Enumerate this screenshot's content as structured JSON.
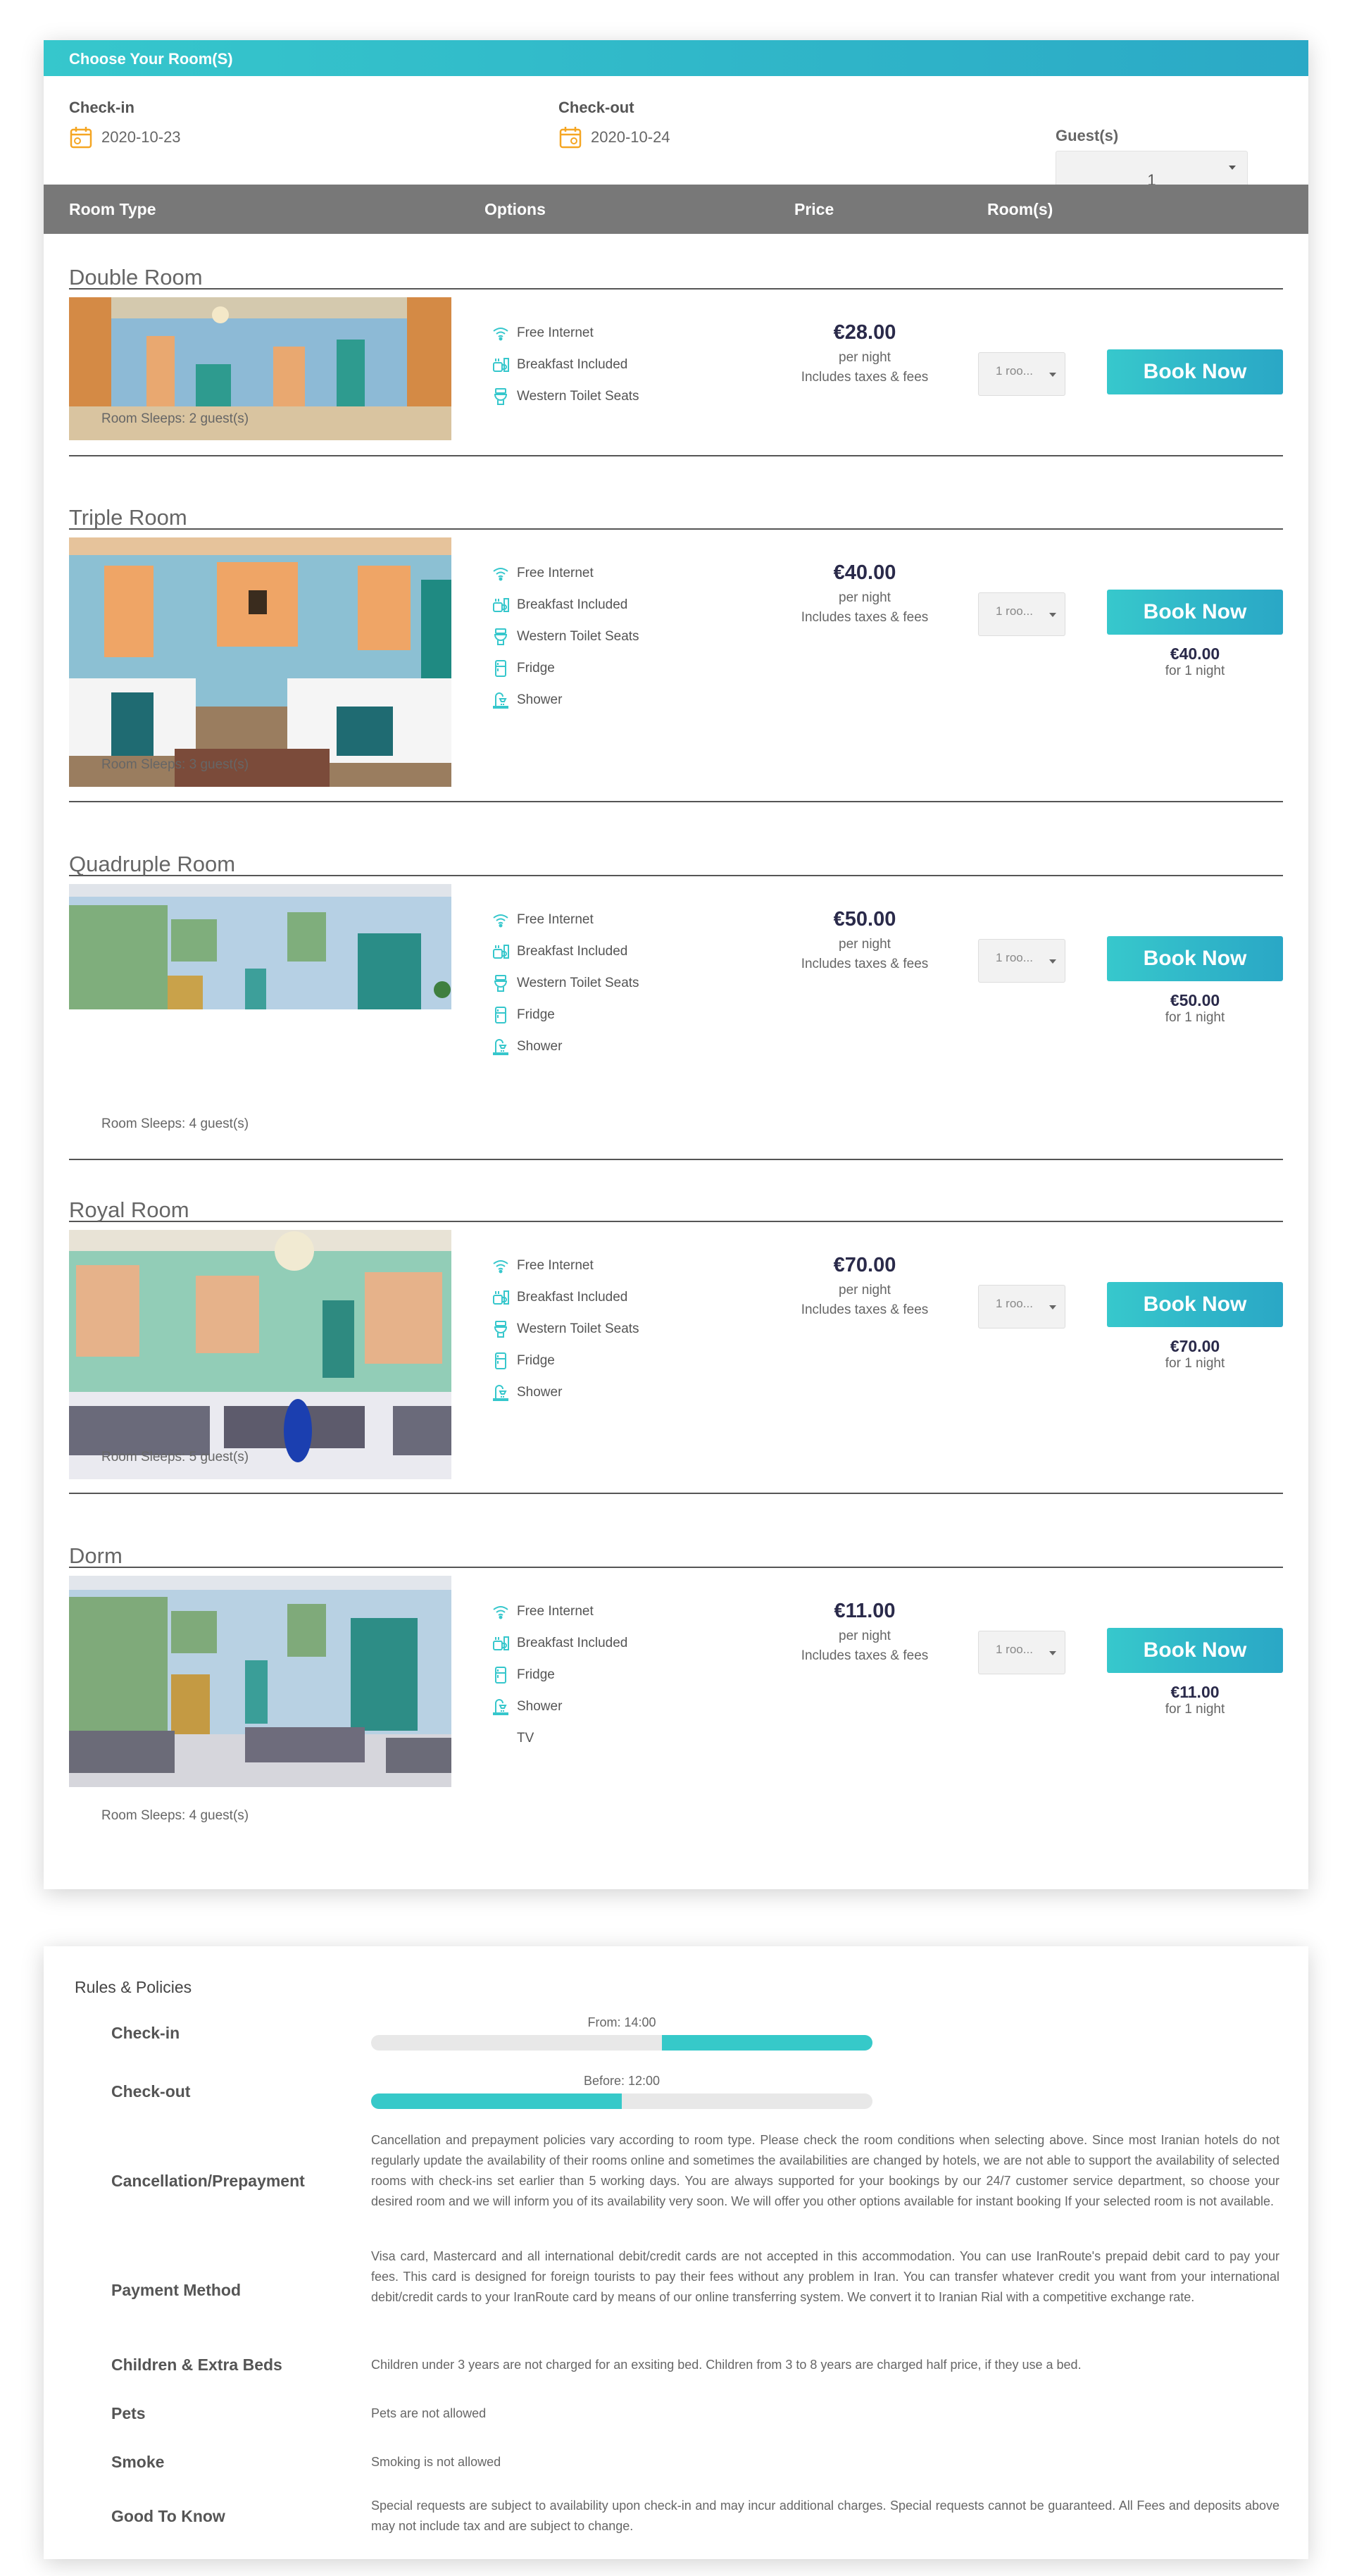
{
  "header": {
    "title": "Choose Your Room(S)"
  },
  "dates": {
    "checkin_label": "Check-in",
    "checkin_value": "2020-10-23",
    "checkout_label": "Check-out",
    "checkout_value": "2020-10-24"
  },
  "guests": {
    "label": "Guest(s)",
    "value": "1"
  },
  "table": {
    "col_room_type": "Room Type",
    "col_options": "Options",
    "col_price": "Price",
    "col_rooms": "Room(s)"
  },
  "rooms": [
    {
      "name": "Double Room",
      "sleeps": "Room Sleeps: 2 guest(s)",
      "amenities": [
        "Free Internet",
        "Breakfast Included",
        "Western Toilet Seats"
      ],
      "price": "€28.00",
      "per_night": "per night",
      "taxes": "Includes taxes & fees",
      "qty": "1 roo...",
      "book": "Book Now"
    },
    {
      "name": "Triple Room",
      "sleeps": "Room Sleeps: 3 guest(s)",
      "amenities": [
        "Free Internet",
        "Breakfast Included",
        "Western Toilet Seats",
        "Fridge",
        "Shower"
      ],
      "price": "€40.00",
      "per_night": "per night",
      "taxes": "Includes taxes & fees",
      "qty": "1 roo...",
      "book": "Book Now",
      "total": "€40.00",
      "total_note": "for 1 night"
    },
    {
      "name": "Quadruple Room",
      "sleeps": "Room Sleeps: 4 guest(s)",
      "amenities": [
        "Free Internet",
        "Breakfast Included",
        "Western Toilet Seats",
        "Fridge",
        "Shower"
      ],
      "price": "€50.00",
      "per_night": "per night",
      "taxes": "Includes taxes & fees",
      "qty": "1 roo...",
      "book": "Book Now",
      "total": "€50.00",
      "total_note": "for 1 night"
    },
    {
      "name": "Royal Room",
      "sleeps": "Room Sleeps: 5 guest(s)",
      "amenities": [
        "Free Internet",
        "Breakfast Included",
        "Western Toilet Seats",
        "Fridge",
        "Shower"
      ],
      "price": "€70.00",
      "per_night": "per night",
      "taxes": "Includes taxes & fees",
      "qty": "1 roo...",
      "book": "Book Now",
      "total": "€70.00",
      "total_note": "for 1 night"
    },
    {
      "name": "Dorm",
      "sleeps": "Room Sleeps: 4 guest(s)",
      "amenities": [
        "Free Internet",
        "Breakfast Included",
        "Fridge",
        "Shower",
        "TV"
      ],
      "price": "€11.00",
      "per_night": "per night",
      "taxes": "Includes taxes & fees",
      "qty": "1 roo...",
      "book": "Book Now",
      "total": "€11.00",
      "total_note": "for 1 night"
    }
  ],
  "rules": {
    "title": "Rules & Policies",
    "checkin_label": "Check-in",
    "checkin_caption": "From: 14:00",
    "checkin_fraction": 0.58,
    "checkout_label": "Check-out",
    "checkout_caption": "Before: 12:00",
    "checkout_fraction": 0.5,
    "cancellation_label": "Cancellation/Prepayment",
    "cancellation_text": "Cancellation and prepayment policies vary according to room type. Please check the room conditions when selecting above. Since most Iranian hotels do not regularly update the availability of their rooms online and sometimes the availabilities are changed by hotels, we are not able to support the availability of selected rooms with check-ins set earlier than 5 working days. You are always supported for your bookings by our 24/7 customer service department, so choose your desired room and we will inform you of its availability very soon. We will offer you other options available for instant booking If your selected room is not available.",
    "payment_label": "Payment Method",
    "payment_text": "Visa card, Mastercard and all international debit/credit cards are not accepted in this accommodation. You can use IranRoute's prepaid debit card to pay your fees. This card is designed for foreign tourists to pay their fees without any problem in Iran. You can transfer whatever credit you want from your international debit/credit cards to your IranRoute card by means of our online transferring system. We convert it to Iranian Rial with a competitive exchange rate.",
    "children_label": "Children & Extra Beds",
    "children_text": "Children under 3 years are not charged for an exsiting bed. Children from 3 to 8 years are charged half price, if they use a bed.",
    "pets_label": "Pets",
    "pets_text": "Pets are not allowed",
    "smoke_label": "Smoke",
    "smoke_text": "Smoking is not allowed",
    "goodtoknow_label": "Good To Know",
    "goodtoknow_text": "Special requests are subject to availability upon check-in and may incur additional charges. Special requests cannot be guaranteed. All Fees and deposits above may not include tax and are subject to change."
  },
  "colors": {
    "accent": "#36c7cc",
    "accent_dark": "#2ba9c6",
    "table_header": "#787878",
    "price": "#2a2a4a"
  }
}
